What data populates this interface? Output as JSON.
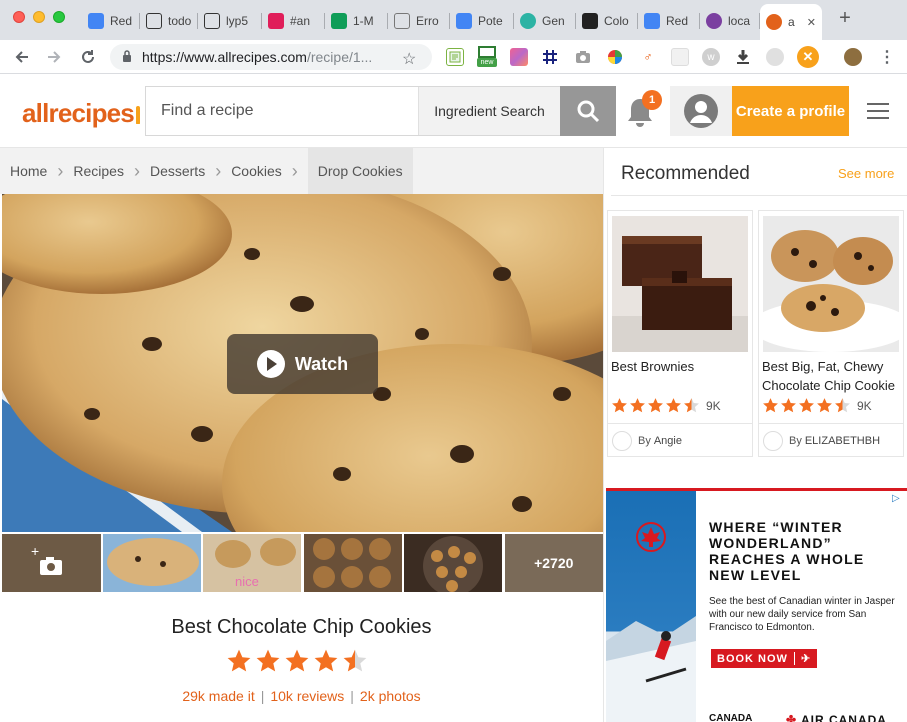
{
  "browser": {
    "tabs": [
      {
        "label": "Red",
        "favicon": "doc-icon",
        "color": "#4285f4"
      },
      {
        "label": "todo",
        "favicon": "cube-icon",
        "color": "#333333"
      },
      {
        "label": "lyp5",
        "favicon": "cube-icon",
        "color": "#333333"
      },
      {
        "label": "#an",
        "favicon": "slack-icon",
        "color": "#e01e5a"
      },
      {
        "label": "1-M",
        "favicon": "sheet-icon",
        "color": "#0f9d58"
      },
      {
        "label": "Erro",
        "favicon": "page-icon",
        "color": "#777777"
      },
      {
        "label": "Pote",
        "favicon": "doc-icon",
        "color": "#4285f4"
      },
      {
        "label": "Gen",
        "favicon": "circle-icon",
        "color": "#2cb3a4"
      },
      {
        "label": "Colo",
        "favicon": "app-icon",
        "color": "#222222"
      },
      {
        "label": "Red",
        "favicon": "doc-icon",
        "color": "#4285f4"
      },
      {
        "label": "loca",
        "favicon": "circle-icon",
        "color": "#7b3fa0"
      },
      {
        "label": "a",
        "favicon": "allrecipes-icon",
        "color": "#e2621b"
      }
    ],
    "close_glyph": "✕",
    "new_tab_glyph": "+",
    "url_main": "https://www.allrecipes.com",
    "url_dim": "/recipe/1...",
    "extension_new_badge": "new"
  },
  "header": {
    "logo_text": "allrecipes",
    "search_placeholder": "Find a recipe",
    "ingredient_search_label": "Ingredient Search",
    "notification_count": "1",
    "create_profile_label": "Create a profile"
  },
  "breadcrumb": {
    "items": [
      "Home",
      "Recipes",
      "Desserts",
      "Cookies",
      "Drop Cookies"
    ]
  },
  "recipe": {
    "watch_label": "Watch",
    "more_photos_label": "+2720",
    "title": "Best Chocolate Chip Cookies",
    "rating": 4.5,
    "made_it": "29k made it",
    "reviews": "10k reviews",
    "photos": "2k photos"
  },
  "recommended": {
    "heading": "Recommended",
    "see_more": "See more",
    "cards": [
      {
        "name": "Best Brownies",
        "rating": 4.5,
        "count": "9K",
        "by_prefix": "By",
        "author": "Angie"
      },
      {
        "name": "Best Big, Fat, Chewy Chocolate Chip Cookie",
        "rating": 4.5,
        "count": "9K",
        "by_prefix": "By",
        "author": "ELIZABETHBH"
      }
    ]
  },
  "ad": {
    "headline": "WHERE “WINTER WONDERLAND” REACHES A WHOLE NEW LEVEL",
    "body": "See the best of Canadian winter in Jasper with our new daily service from San Francisco to Edmonton.",
    "cta": "BOOK NOW",
    "footer_left": "CANADA",
    "footer_right": "AIR CANADA"
  },
  "colors": {
    "brand_orange": "#e2621b",
    "cta_yellow": "#f8a11b",
    "star_orange": "#f37021",
    "ad_red": "#d71920"
  }
}
